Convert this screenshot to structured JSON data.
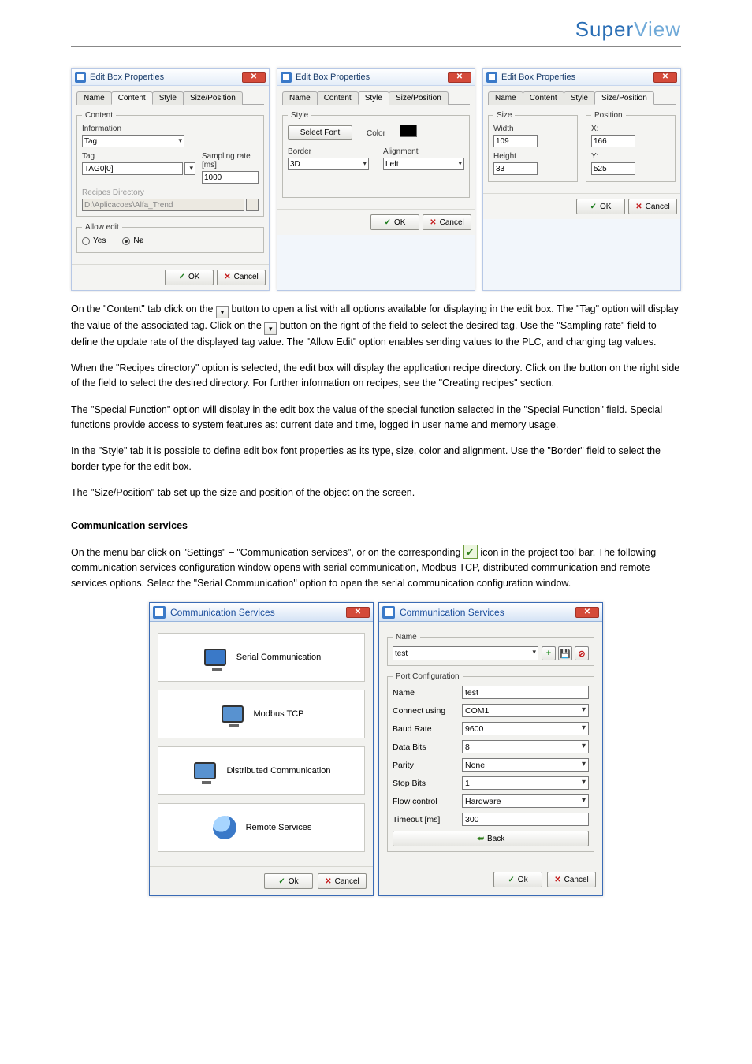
{
  "brand": {
    "super": "Super",
    "view": "View"
  },
  "top_windows_title": "Edit Box Properties",
  "tabs": {
    "name": "Name",
    "content": "Content",
    "style": "Style",
    "sizepos": "Size/Position"
  },
  "editbox_content": {
    "fieldset": "Content",
    "information_lbl": "Information",
    "information_val": "Tag",
    "tag_lbl": "Tag",
    "tag_val": "TAG0[0]",
    "sampling_lbl": "Sampling rate [ms]",
    "sampling_val": "1000",
    "recipes_lbl": "Recipes Directory",
    "recipes_val": "D:\\Aplicacoes\\Alfa_Trend",
    "allow_fieldset": "Allow edit",
    "allow_yes": "Yes",
    "allow_no": "No"
  },
  "editbox_style": {
    "fieldset": "Style",
    "select_font_btn": "Select Font",
    "color_lbl": "Color",
    "border_lbl": "Border",
    "border_val": "3D",
    "alignment_lbl": "Alignment",
    "alignment_val": "Left"
  },
  "editbox_sizepos": {
    "size_fieldset": "Size",
    "width_lbl": "Width",
    "width_val": "109",
    "height_lbl": "Height",
    "height_val": "33",
    "pos_fieldset": "Position",
    "x_lbl": "X:",
    "x_val": "166",
    "y_lbl": "Y:",
    "y_val": "525"
  },
  "buttons": {
    "ok": "OK",
    "cancel": "Cancel",
    "ok_u": "Ok",
    "cancel_u": "Cancel",
    "back": "Back"
  },
  "prose": {
    "p1a": "On the \"Content\" tab click on the",
    "p1b": "button to open a list with all options available for displaying in the edit box. The \"Tag\" option will display the value of the associated tag. Click on the",
    "p1c": "button on the right of the field to select the desired tag. Use the \"Sampling rate\" field to define the update rate of the displayed tag value. The \"Allow Edit\" option enables sending values to the PLC, and changing tag values.",
    "p2": "When the \"Recipes directory\" option is selected, the edit box will display the application recipe directory. Click on the button on the right side of the field to select the desired directory. For further information on recipes, see the \"Creating recipes\" section.",
    "p3": "The \"Special Function\" option will display in the edit box the value of the special function selected in the \"Special Function\" field. Special functions provide access to system features as: current date and time, logged in user name and memory usage.",
    "p4": "In the \"Style\" tab it is possible to define edit box font properties as its type, size, color and alignment. Use the \"Border\" field to select the border type for the edit box.",
    "p5": "The \"Size/Position\" tab set up the size and position of the object on the screen.",
    "h_comm": "Communication services",
    "p6a": "On the menu bar click on \"Settings\" – \"Communication services\", or on the corresponding",
    "p6b": "icon in the project tool bar. The following communication services configuration window opens with serial communication, Modbus TCP, distributed communication and remote services options. Select the \"Serial Communication\" option to open the serial communication configuration window."
  },
  "comm_windows_title": "Communication Services",
  "comm_left": {
    "serial": "Serial Communication",
    "modbus": "Modbus TCP",
    "dist": "Distributed Communication",
    "remote": "Remote Services"
  },
  "comm_right": {
    "name_fieldset": "Name",
    "name_val": "test",
    "port_fieldset": "Port Configuration",
    "name_lbl": "Name",
    "name_field_val": "test",
    "connect_lbl": "Connect using",
    "connect_val": "COM1",
    "baud_lbl": "Baud Rate",
    "baud_val": "9600",
    "databits_lbl": "Data Bits",
    "databits_val": "8",
    "parity_lbl": "Parity",
    "parity_val": "None",
    "stopbits_lbl": "Stop Bits",
    "stopbits_val": "1",
    "flow_lbl": "Flow control",
    "flow_val": "Hardware",
    "timeout_lbl": "Timeout [ms]",
    "timeout_val": "300"
  }
}
